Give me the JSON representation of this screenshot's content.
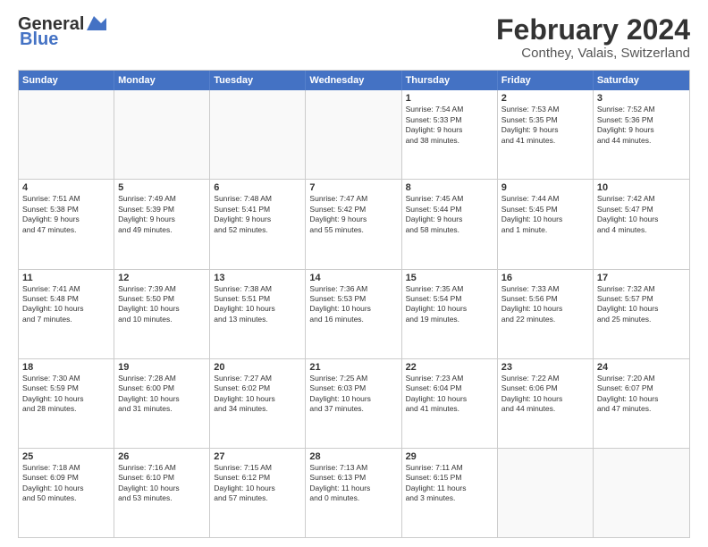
{
  "header": {
    "logo_general": "General",
    "logo_blue": "Blue",
    "title": "February 2024",
    "subtitle": "Conthey, Valais, Switzerland"
  },
  "days_of_week": [
    "Sunday",
    "Monday",
    "Tuesday",
    "Wednesday",
    "Thursday",
    "Friday",
    "Saturday"
  ],
  "weeks": [
    [
      {
        "day": "",
        "info": ""
      },
      {
        "day": "",
        "info": ""
      },
      {
        "day": "",
        "info": ""
      },
      {
        "day": "",
        "info": ""
      },
      {
        "day": "1",
        "info": "Sunrise: 7:54 AM\nSunset: 5:33 PM\nDaylight: 9 hours\nand 38 minutes."
      },
      {
        "day": "2",
        "info": "Sunrise: 7:53 AM\nSunset: 5:35 PM\nDaylight: 9 hours\nand 41 minutes."
      },
      {
        "day": "3",
        "info": "Sunrise: 7:52 AM\nSunset: 5:36 PM\nDaylight: 9 hours\nand 44 minutes."
      }
    ],
    [
      {
        "day": "4",
        "info": "Sunrise: 7:51 AM\nSunset: 5:38 PM\nDaylight: 9 hours\nand 47 minutes."
      },
      {
        "day": "5",
        "info": "Sunrise: 7:49 AM\nSunset: 5:39 PM\nDaylight: 9 hours\nand 49 minutes."
      },
      {
        "day": "6",
        "info": "Sunrise: 7:48 AM\nSunset: 5:41 PM\nDaylight: 9 hours\nand 52 minutes."
      },
      {
        "day": "7",
        "info": "Sunrise: 7:47 AM\nSunset: 5:42 PM\nDaylight: 9 hours\nand 55 minutes."
      },
      {
        "day": "8",
        "info": "Sunrise: 7:45 AM\nSunset: 5:44 PM\nDaylight: 9 hours\nand 58 minutes."
      },
      {
        "day": "9",
        "info": "Sunrise: 7:44 AM\nSunset: 5:45 PM\nDaylight: 10 hours\nand 1 minute."
      },
      {
        "day": "10",
        "info": "Sunrise: 7:42 AM\nSunset: 5:47 PM\nDaylight: 10 hours\nand 4 minutes."
      }
    ],
    [
      {
        "day": "11",
        "info": "Sunrise: 7:41 AM\nSunset: 5:48 PM\nDaylight: 10 hours\nand 7 minutes."
      },
      {
        "day": "12",
        "info": "Sunrise: 7:39 AM\nSunset: 5:50 PM\nDaylight: 10 hours\nand 10 minutes."
      },
      {
        "day": "13",
        "info": "Sunrise: 7:38 AM\nSunset: 5:51 PM\nDaylight: 10 hours\nand 13 minutes."
      },
      {
        "day": "14",
        "info": "Sunrise: 7:36 AM\nSunset: 5:53 PM\nDaylight: 10 hours\nand 16 minutes."
      },
      {
        "day": "15",
        "info": "Sunrise: 7:35 AM\nSunset: 5:54 PM\nDaylight: 10 hours\nand 19 minutes."
      },
      {
        "day": "16",
        "info": "Sunrise: 7:33 AM\nSunset: 5:56 PM\nDaylight: 10 hours\nand 22 minutes."
      },
      {
        "day": "17",
        "info": "Sunrise: 7:32 AM\nSunset: 5:57 PM\nDaylight: 10 hours\nand 25 minutes."
      }
    ],
    [
      {
        "day": "18",
        "info": "Sunrise: 7:30 AM\nSunset: 5:59 PM\nDaylight: 10 hours\nand 28 minutes."
      },
      {
        "day": "19",
        "info": "Sunrise: 7:28 AM\nSunset: 6:00 PM\nDaylight: 10 hours\nand 31 minutes."
      },
      {
        "day": "20",
        "info": "Sunrise: 7:27 AM\nSunset: 6:02 PM\nDaylight: 10 hours\nand 34 minutes."
      },
      {
        "day": "21",
        "info": "Sunrise: 7:25 AM\nSunset: 6:03 PM\nDaylight: 10 hours\nand 37 minutes."
      },
      {
        "day": "22",
        "info": "Sunrise: 7:23 AM\nSunset: 6:04 PM\nDaylight: 10 hours\nand 41 minutes."
      },
      {
        "day": "23",
        "info": "Sunrise: 7:22 AM\nSunset: 6:06 PM\nDaylight: 10 hours\nand 44 minutes."
      },
      {
        "day": "24",
        "info": "Sunrise: 7:20 AM\nSunset: 6:07 PM\nDaylight: 10 hours\nand 47 minutes."
      }
    ],
    [
      {
        "day": "25",
        "info": "Sunrise: 7:18 AM\nSunset: 6:09 PM\nDaylight: 10 hours\nand 50 minutes."
      },
      {
        "day": "26",
        "info": "Sunrise: 7:16 AM\nSunset: 6:10 PM\nDaylight: 10 hours\nand 53 minutes."
      },
      {
        "day": "27",
        "info": "Sunrise: 7:15 AM\nSunset: 6:12 PM\nDaylight: 10 hours\nand 57 minutes."
      },
      {
        "day": "28",
        "info": "Sunrise: 7:13 AM\nSunset: 6:13 PM\nDaylight: 11 hours\nand 0 minutes."
      },
      {
        "day": "29",
        "info": "Sunrise: 7:11 AM\nSunset: 6:15 PM\nDaylight: 11 hours\nand 3 minutes."
      },
      {
        "day": "",
        "info": ""
      },
      {
        "day": "",
        "info": ""
      }
    ]
  ]
}
